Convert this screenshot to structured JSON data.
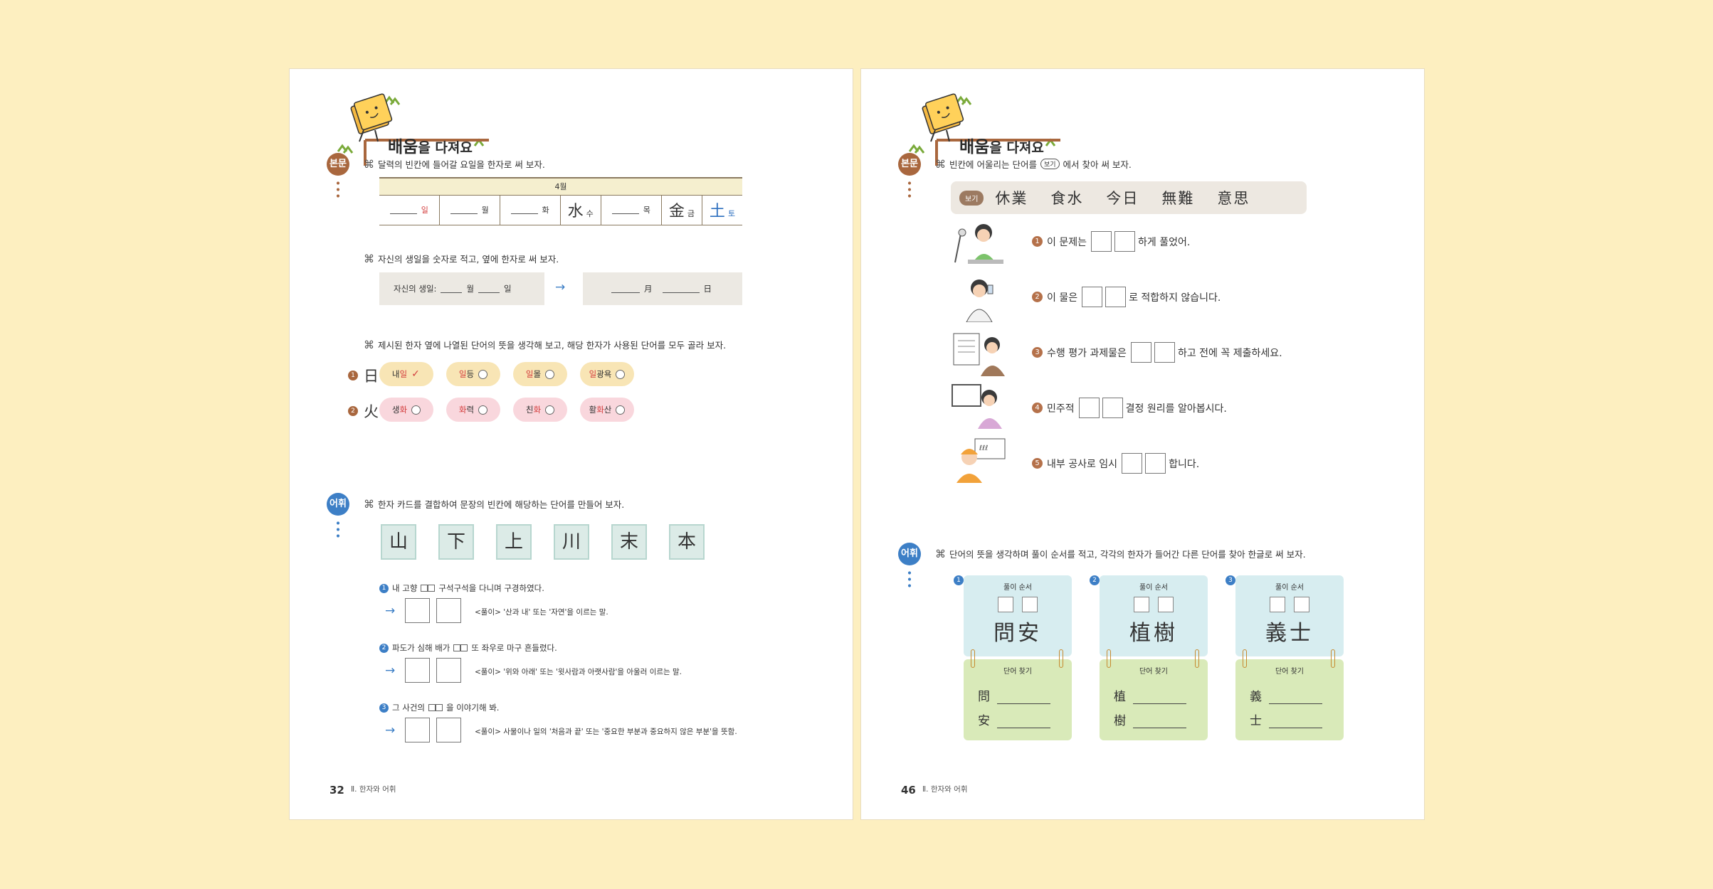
{
  "header": {
    "title_big": "배움",
    "title_rest": "을 다져요"
  },
  "left": {
    "tag_bonmun": "본문",
    "tag_eohwi": "어휘",
    "q1": "달력의 빈칸에 들어갈 요일을 한자로 써 보자.",
    "calendar": {
      "month": "4월",
      "cells": [
        {
          "hanja": "",
          "label": "일",
          "style": "red"
        },
        {
          "hanja": "",
          "label": "월",
          "style": ""
        },
        {
          "hanja": "",
          "label": "화",
          "style": ""
        },
        {
          "hanja": "水",
          "label": "수",
          "style": ""
        },
        {
          "hanja": "",
          "label": "목",
          "style": ""
        },
        {
          "hanja": "金",
          "label": "금",
          "style": ""
        },
        {
          "hanja": "土",
          "label": "토",
          "style": "blue"
        }
      ]
    },
    "q2": "자신의 생일을 숫자로 적고, 옆에 한자로 써 보자.",
    "birthday": {
      "prefix": "자신의 생일:",
      "month": "월",
      "day": "일",
      "hanja_month": "月",
      "hanja_day": "日"
    },
    "q3": "제시된 한자 옆에 나열된 단어의 뜻을 생각해 보고, 해당 한자가 사용된 단어를 모두 골라 보자.",
    "rows": [
      {
        "num": "1",
        "hanja": "日",
        "words": [
          [
            "내",
            "일",
            ""
          ],
          [
            "",
            "일",
            "등"
          ],
          [
            "",
            "일",
            "몰"
          ],
          [
            "",
            "일",
            "광욕"
          ]
        ]
      },
      {
        "num": "2",
        "hanja": "火",
        "words": [
          [
            "생",
            "화",
            ""
          ],
          [
            "",
            "화",
            "력"
          ],
          [
            "친",
            "화",
            ""
          ],
          [
            "활",
            "화",
            "산"
          ]
        ]
      }
    ],
    "q4": "한자 카드를 결합하여 문장의 빈칸에 해당하는 단어를 만들어 보자.",
    "cards": [
      "山",
      "下",
      "上",
      "川",
      "末",
      "本"
    ],
    "sentences": [
      {
        "num": "1",
        "before": "내 고향",
        "after": "구석구석을 다니며 구경하였다.",
        "expl": "<풀이> '산과 내' 또는 '자연'을 이르는 말."
      },
      {
        "num": "2",
        "before": "파도가 심해 배가",
        "after": "또 좌우로 마구 흔들렸다.",
        "expl": "<풀이> '위와 아래' 또는 '윗사람과 아랫사람'을 아울러 이르는 말."
      },
      {
        "num": "3",
        "before": "그 사건의",
        "after": "을 이야기해 봐.",
        "expl": "<풀이> 사물이나 일의 '처음과 끝' 또는 '중요한 부분과 중요하지 않은 부분'을 뜻함."
      }
    ],
    "page_num": "32",
    "page_label": "Ⅱ. 한자와 어휘"
  },
  "right": {
    "tag_bonmun": "본문",
    "tag_eohwi": "어휘",
    "q1_before": "빈칸에 어울리는 단어를",
    "q1_bogi": "보기",
    "q1_after": "에서 찾아 써 보자.",
    "bogi_label": "보기",
    "bogi_words": [
      "休業",
      "食水",
      "今日",
      "無難",
      "意思"
    ],
    "sentences": [
      {
        "num": "1",
        "before": "이 문제는",
        "after": "하게 풀었어."
      },
      {
        "num": "2",
        "before": "이 물은",
        "after": "로 적합하지 않습니다."
      },
      {
        "num": "3",
        "before": "수행 평가 과제물은",
        "after": "하고 전에 꼭 제출하세요."
      },
      {
        "num": "4",
        "before": "민주적",
        "after": "결정 원리를 알아봅시다."
      },
      {
        "num": "5",
        "before": "내부 공사로 임시",
        "after": "합니다."
      }
    ],
    "q2": "단어의 뜻을 생각하며 풀이 순서를 적고, 각각의 한자가 들어간 다른 단어를 찾아 한글로 써 보자.",
    "word_cards": [
      {
        "num": "1",
        "top_label": "풀이 순서",
        "word": "問安",
        "bottom_label": "단어 찾기",
        "c1": "問",
        "c2": "安"
      },
      {
        "num": "2",
        "top_label": "풀이 순서",
        "word": "植樹",
        "bottom_label": "단어 찾기",
        "c1": "植",
        "c2": "樹"
      },
      {
        "num": "3",
        "top_label": "풀이 순서",
        "word": "義士",
        "bottom_label": "단어 찾기",
        "c1": "義",
        "c2": "士"
      }
    ],
    "page_num": "46",
    "page_label": "Ⅱ. 한자와 어휘"
  },
  "colors": {
    "background": "#fdefc0",
    "brown": "#a9673e",
    "blue": "#3d7fc6",
    "red": "#d33d3d"
  }
}
